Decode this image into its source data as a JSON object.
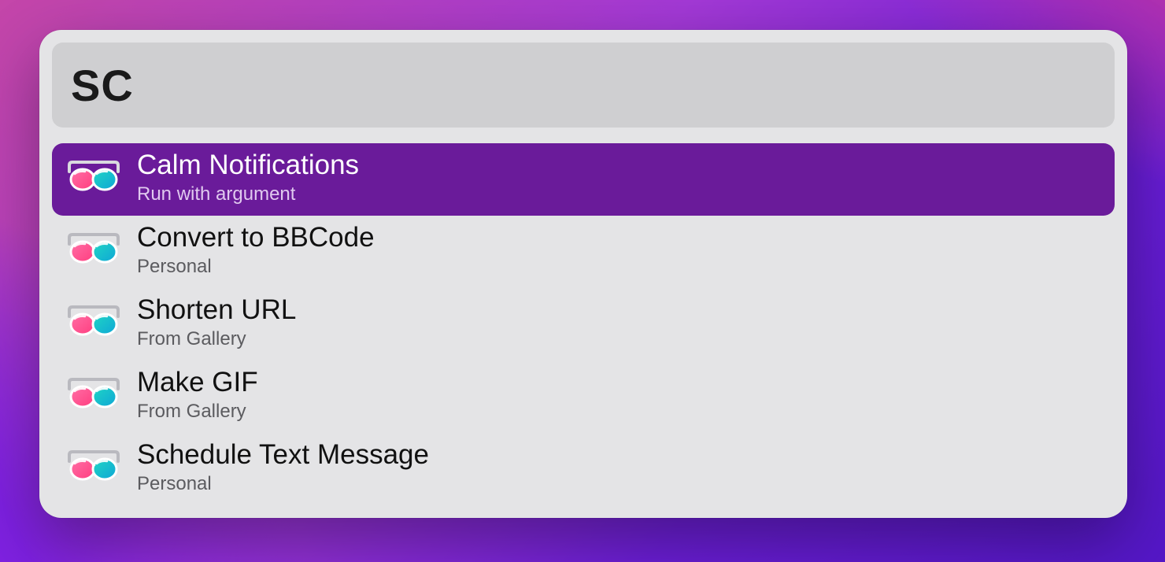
{
  "search": {
    "value": "SC",
    "placeholder": ""
  },
  "selection": {
    "highlight_color": "#6a1b9a"
  },
  "results": [
    {
      "title": "Calm Notifications",
      "subtitle": "Run with argument",
      "icon": "glasses-icon",
      "selected": true
    },
    {
      "title": "Convert to BBCode",
      "subtitle": "Personal",
      "icon": "glasses-icon",
      "selected": false
    },
    {
      "title": "Shorten URL",
      "subtitle": "From Gallery",
      "icon": "glasses-icon",
      "selected": false
    },
    {
      "title": "Make GIF",
      "subtitle": "From Gallery",
      "icon": "glasses-icon",
      "selected": false
    },
    {
      "title": "Schedule Text Message",
      "subtitle": "Personal",
      "icon": "glasses-icon",
      "selected": false
    }
  ]
}
